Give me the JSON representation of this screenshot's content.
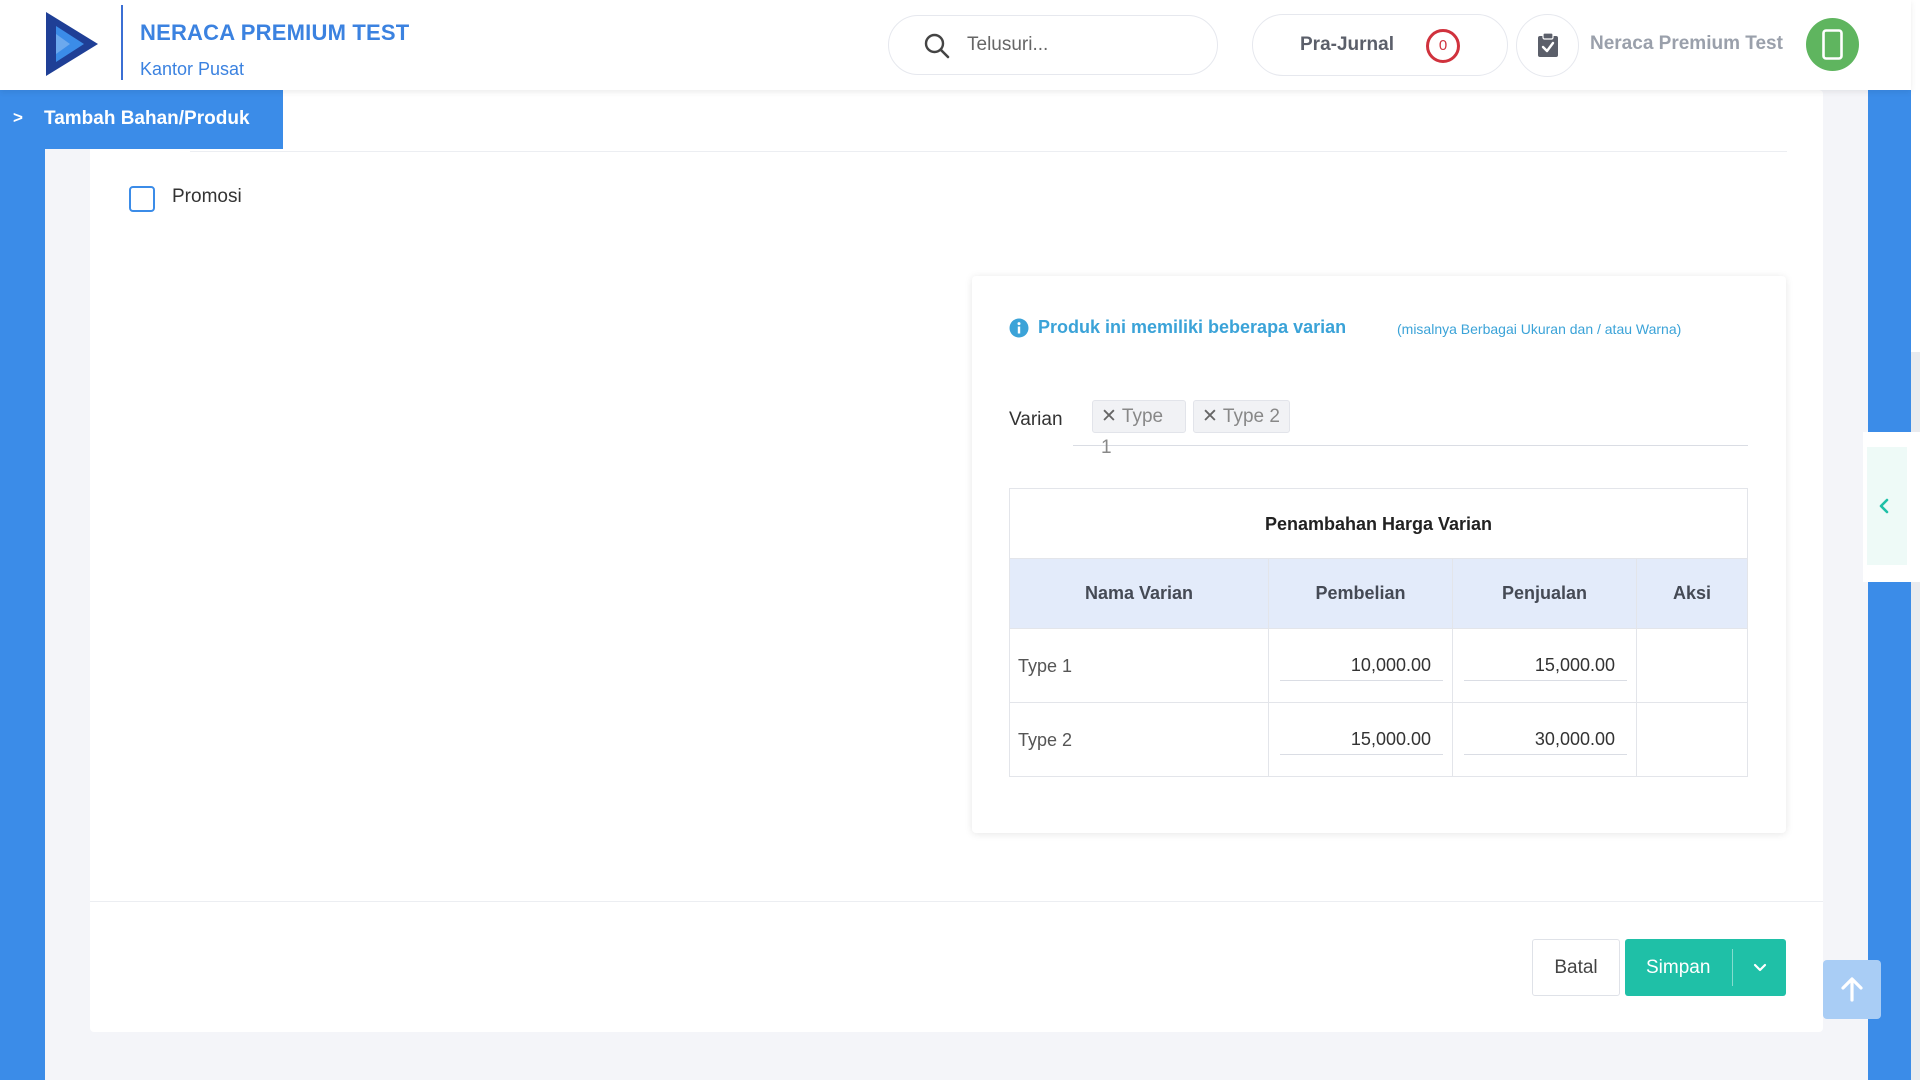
{
  "header": {
    "brand_title": "NERACA PREMIUM TEST",
    "brand_subtitle": "Kantor Pusat",
    "search_placeholder": "Telusuri...",
    "prajurnal_label": "Pra-Jurnal",
    "prajurnal_count": "0",
    "user_name": "Neraca Premium Test"
  },
  "page_tab": {
    "chevron": ">",
    "label": "Tambah Bahan/Produk"
  },
  "form": {
    "promo_label": "Promosi",
    "promo_checked": false
  },
  "variants": {
    "info_title": "Produk ini memiliki beberapa varian",
    "info_hint": "(misalnya Berbagai Ukuran dan / atau Warna)",
    "varian_label": "Varian",
    "chips": [
      "Type 1",
      "Type 2"
    ],
    "table": {
      "caption": "Penambahan Harga Varian",
      "columns": [
        "Nama Varian",
        "Pembelian",
        "Penjualan",
        "Aksi"
      ],
      "rows": [
        {
          "name": "Type 1",
          "pembelian": "10,000.00",
          "penjualan": "15,000.00"
        },
        {
          "name": "Type 2",
          "pembelian": "15,000.00",
          "penjualan": "30,000.00"
        }
      ]
    }
  },
  "actions": {
    "cancel_label": "Batal",
    "save_label": "Simpan"
  },
  "colors": {
    "primary_blue": "#3b8ce8",
    "teal": "#1fc0a7",
    "danger": "#d0323d",
    "info": "#3ba3d8"
  }
}
